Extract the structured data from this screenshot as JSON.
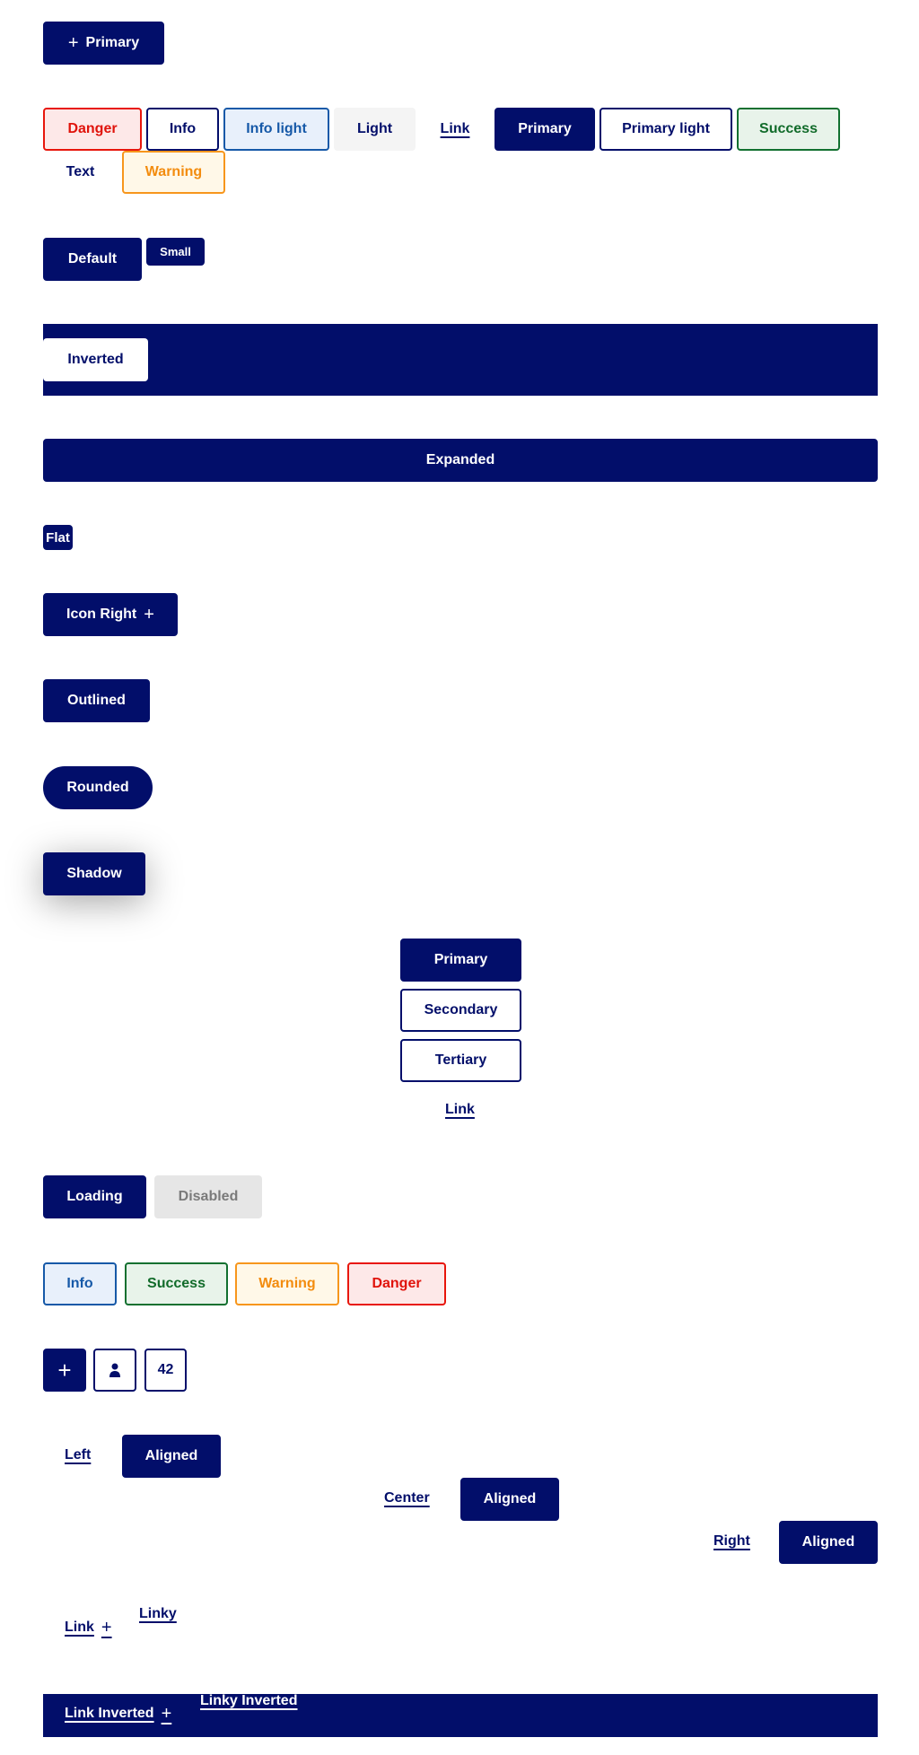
{
  "icon_primary": {
    "label": "Primary",
    "icon": "plus-icon"
  },
  "variants": [
    "Danger",
    "Info",
    "Info light",
    "Light",
    "Link",
    "Primary",
    "Primary light",
    "Success",
    "Text",
    "Warning"
  ],
  "sizes": {
    "default": "Default",
    "small": "Small"
  },
  "inverted": "Inverted",
  "expanded": "Expanded",
  "flat": "Flat",
  "icon_right": "Icon Right",
  "outlined": "Outlined",
  "rounded": "Rounded",
  "shadow": "Shadow",
  "stack": [
    "Primary",
    "Secondary",
    "Tertiary",
    "Link"
  ],
  "states": {
    "loading": "Loading",
    "disabled": "Disabled"
  },
  "status": [
    "Info",
    "Success",
    "Warning",
    "Danger"
  ],
  "icon_buttons": {
    "count": "42"
  },
  "aligned": {
    "left": "Left",
    "center": "Center",
    "right": "Right",
    "button": "Aligned"
  },
  "links": {
    "link": "Link",
    "linky": "Linky",
    "link_inverted": "Link Inverted",
    "linky_inverted": "Linky Inverted"
  },
  "colors": {
    "navy": "#020e6a",
    "danger": "#e8160c",
    "info": "#1659a8",
    "success": "#127030",
    "warning": "#f7961c"
  }
}
